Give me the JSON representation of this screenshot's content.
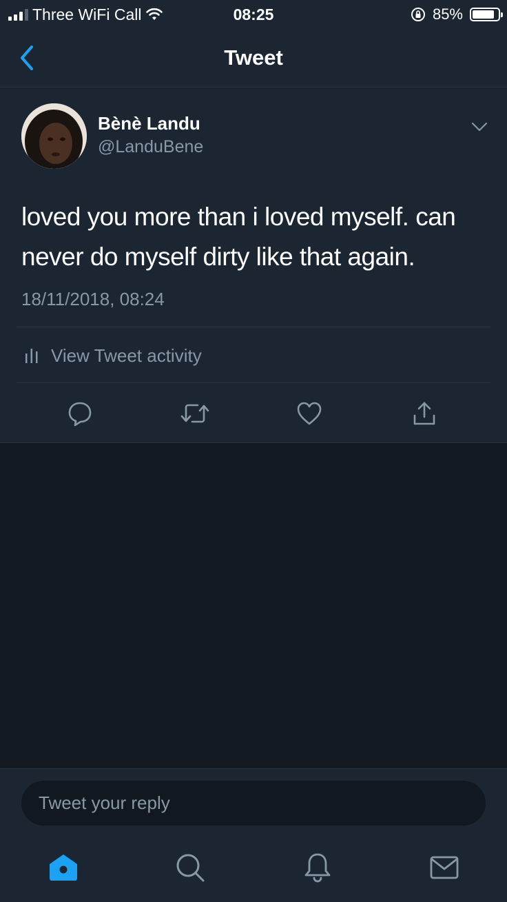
{
  "status_bar": {
    "carrier": "Three WiFi Call",
    "time": "08:25",
    "battery": "85%",
    "battery_level": 0.85,
    "icons": [
      "signal-icon",
      "wifi-icon",
      "rotation-lock-icon",
      "battery-icon"
    ]
  },
  "nav": {
    "title": "Tweet",
    "back_icon": "chevron-left-icon"
  },
  "tweet": {
    "author_name": "Bènè Landu",
    "author_handle": "@LanduBene",
    "text": "loved you more than i loved myself. can never do myself dirty like that again.",
    "timestamp": "18/11/2018, 08:24",
    "activity_label": "View Tweet activity",
    "actions": [
      "reply-icon",
      "retweet-icon",
      "like-icon",
      "share-icon"
    ]
  },
  "reply": {
    "placeholder": "Tweet your reply"
  },
  "tab_bar": {
    "tabs": [
      "home-icon",
      "search-icon",
      "notifications-icon",
      "messages-icon"
    ],
    "active": "home-icon"
  },
  "colors": {
    "background": "#141a22",
    "panel": "#1c2532",
    "accent": "#1da1f2",
    "secondary_text": "#8899a6"
  }
}
